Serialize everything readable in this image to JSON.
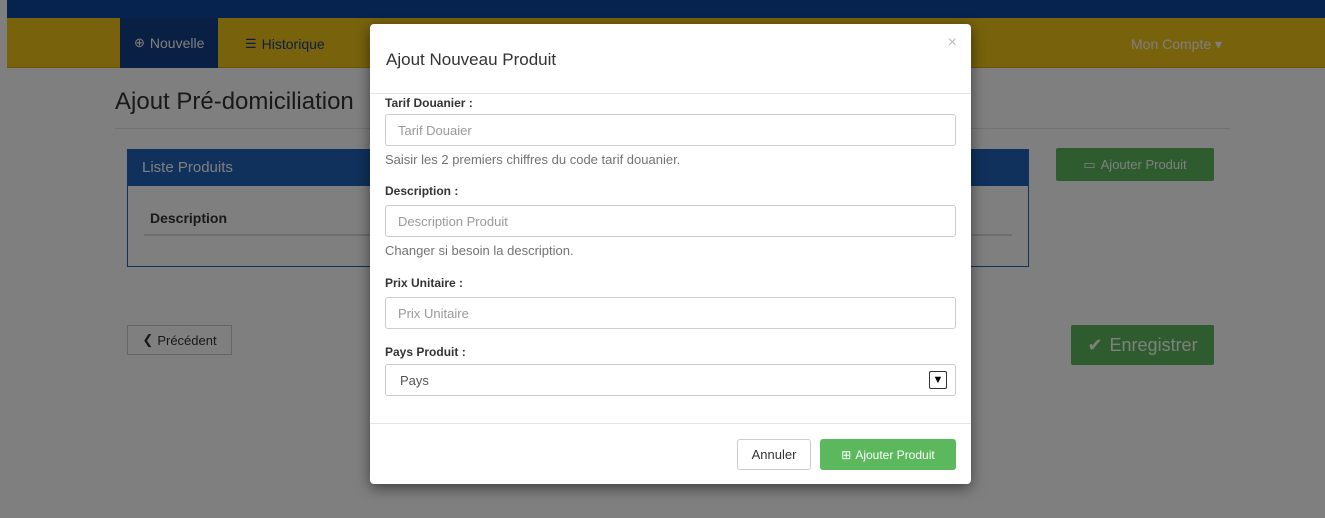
{
  "nav": {
    "new_label": "Nouvelle",
    "history_label": "Historique",
    "account_label": "Mon Compte ▾"
  },
  "page": {
    "title": "Ajout Pré-domiciliation",
    "panel_title": "Liste Produits",
    "column_description": "Description",
    "add_product_label": "Ajouter Produit",
    "previous_label": "Précédent",
    "save_label": "Enregistrer"
  },
  "modal": {
    "title": "Ajout Nouveau Produit",
    "close_symbol": "×",
    "tariff": {
      "label": "Tarif Douanier :",
      "placeholder": "Tarif Douaier",
      "help": "Saisir les 2 premiers chiffres du code tarif douanier."
    },
    "description": {
      "label": "Description :",
      "placeholder": "Description Produit",
      "help": "Changer si besoin la description."
    },
    "unit_price": {
      "label": "Prix Unitaire :",
      "placeholder": "Prix Unitaire"
    },
    "country": {
      "label": "Pays Produit :",
      "selected": "Pays"
    },
    "cancel_label": "Annuler",
    "submit_label": "Ajouter Produit"
  },
  "colors": {
    "navbar": "#f0c419",
    "topbar": "#0d47a1",
    "panel": "#1e63b8",
    "success": "#5cb85c"
  }
}
